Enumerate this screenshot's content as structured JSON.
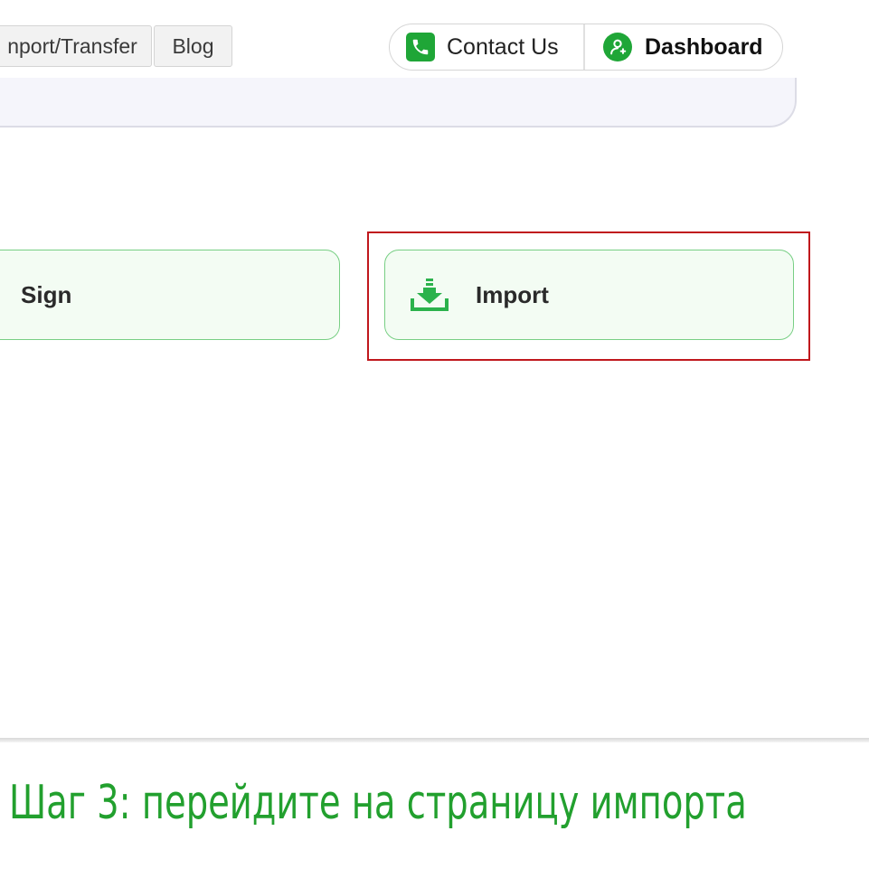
{
  "nav": {
    "import_transfer_label": "nport/Transfer",
    "blog_label": "Blog"
  },
  "actions": {
    "contact_label": "Contact Us",
    "contact_icon": "phone-icon",
    "dashboard_label": "Dashboard",
    "dashboard_icon": "user-icon"
  },
  "cards": {
    "sign_label": "Sign",
    "import_label": "Import",
    "import_icon": "download-icon"
  },
  "caption": {
    "text": "Шаг 3: перейдите на страницу импорта"
  },
  "colors": {
    "brand_green": "#1fa637",
    "card_border": "#78cf84",
    "card_bg": "#f3fcf3",
    "highlight_red": "#c0181d",
    "caption_green": "#22a02e"
  }
}
